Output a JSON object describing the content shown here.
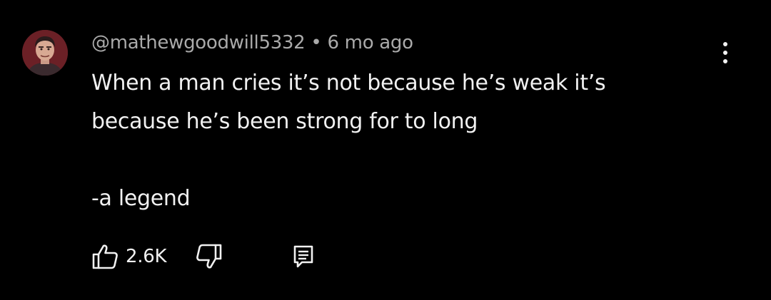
{
  "comment": {
    "author": "@mathewgoodwill5332",
    "separator": "•",
    "time": "6 mo ago",
    "lines": [
      "When a man cries it’s not because he’s weak it’s",
      "because he’s been strong for to long"
    ],
    "signature": "-a legend",
    "like_count": "2.6K"
  },
  "icons": {
    "more": "more-vert-icon",
    "like": "thumbs-up-icon",
    "dislike": "thumbs-down-icon",
    "reply": "comment-reply-icon"
  },
  "colors": {
    "background": "#000000",
    "text_primary": "#f1f1f1",
    "text_secondary": "#aaaaaa"
  }
}
